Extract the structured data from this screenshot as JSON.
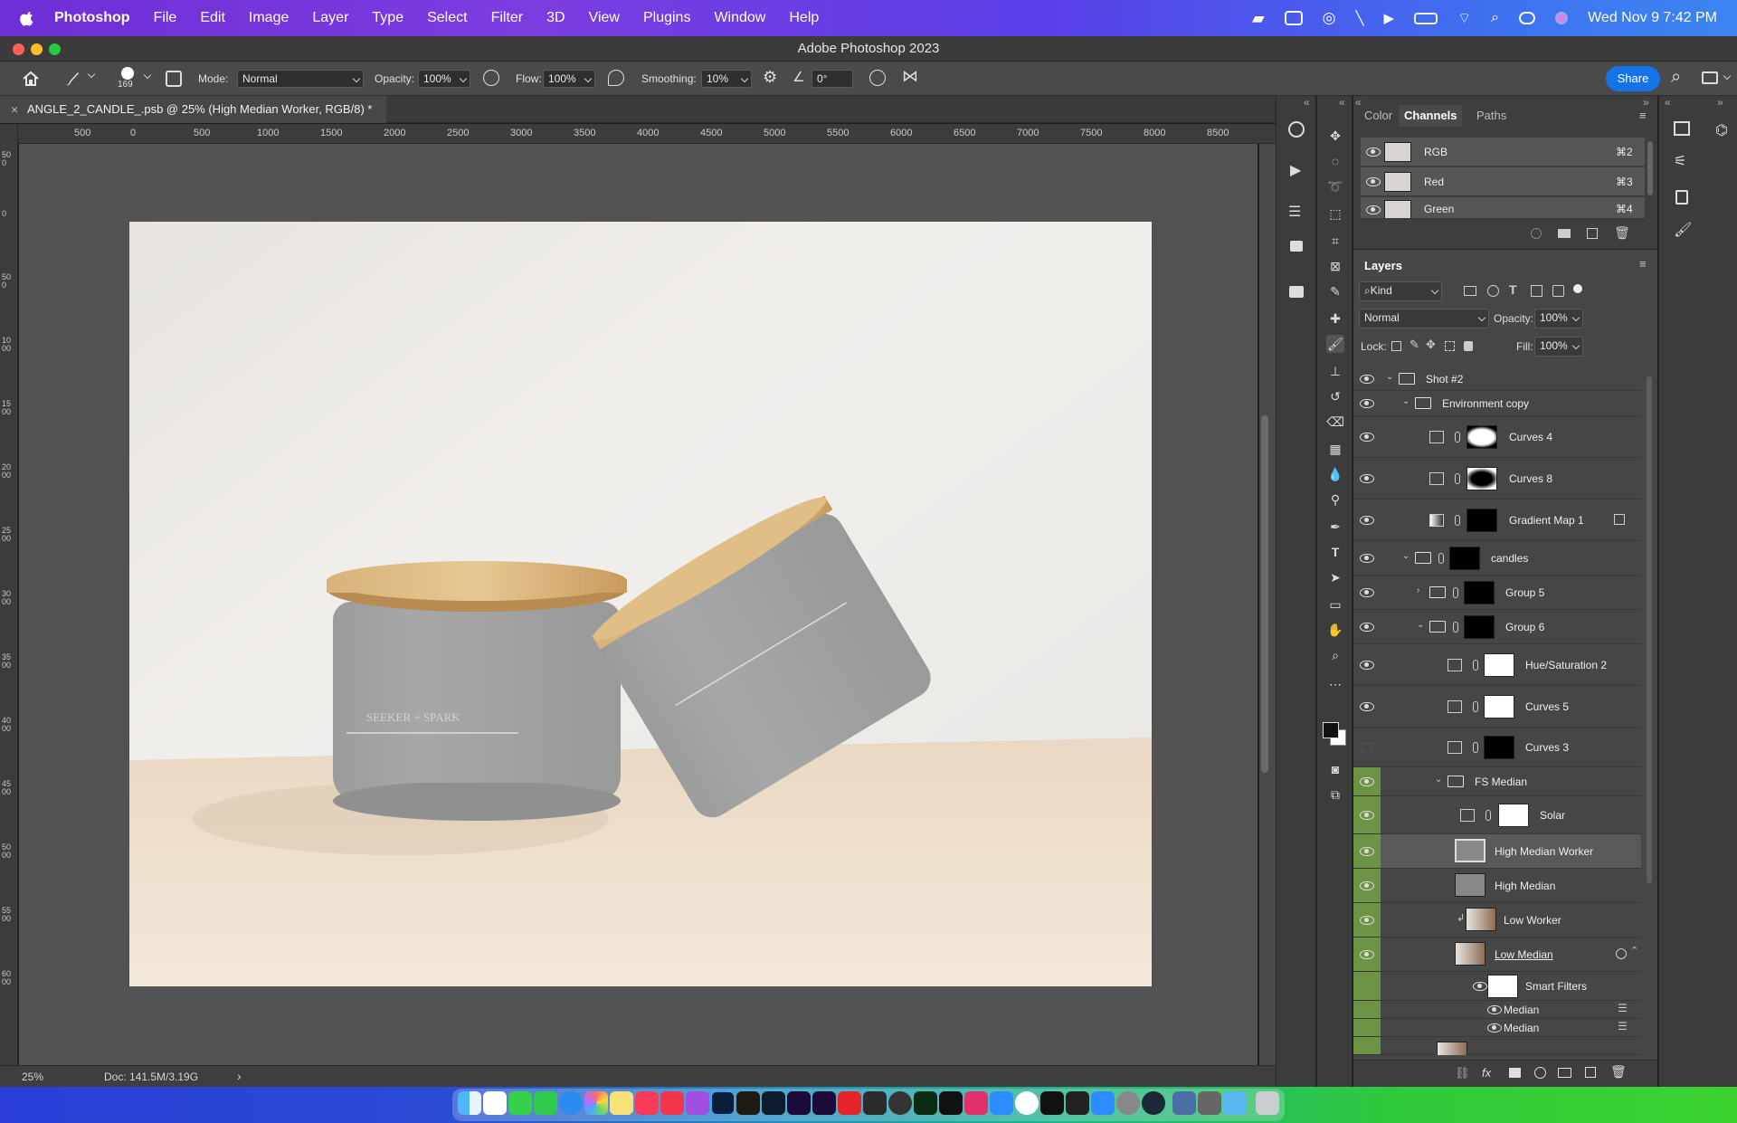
{
  "menubar": {
    "app_name": "Photoshop",
    "menus": [
      "File",
      "Edit",
      "Image",
      "Layer",
      "Type",
      "Select",
      "Filter",
      "3D",
      "View",
      "Plugins",
      "Window",
      "Help"
    ],
    "datetime": "Wed Nov 9  7:42 PM"
  },
  "window": {
    "title": "Adobe Photoshop 2023"
  },
  "options": {
    "brush_size": "169",
    "mode_label": "Mode:",
    "mode_value": "Normal",
    "opacity_label": "Opacity:",
    "opacity_value": "100%",
    "flow_label": "Flow:",
    "flow_value": "100%",
    "smoothing_label": "Smoothing:",
    "smoothing_value": "10%",
    "angle_value": "0°",
    "share_label": "Share"
  },
  "document": {
    "tab_title": "ANGLE_2_CANDLE_.psb @ 25% (High Median Worker, RGB/8) *",
    "zoom": "25%",
    "doc_size": "Doc: 141.5M/3.19G"
  },
  "rulers": {
    "h_labels": [
      "500",
      "0",
      "500",
      "1000",
      "1500",
      "2000",
      "2500",
      "3000",
      "3500",
      "4000",
      "4500",
      "5000",
      "5500",
      "6000",
      "6500",
      "7000",
      "7500",
      "8000",
      "8500"
    ],
    "v_labels": [
      "500",
      "0",
      "500",
      "1000",
      "1500",
      "2000",
      "2500",
      "3000",
      "3500",
      "4000",
      "4500",
      "5000",
      "5500",
      "6000"
    ]
  },
  "channels_panel": {
    "tabs": [
      "Color",
      "Channels",
      "Paths"
    ],
    "active_tab": "Channels",
    "rows": [
      {
        "name": "RGB",
        "shortcut": "⌘2"
      },
      {
        "name": "Red",
        "shortcut": "⌘3"
      },
      {
        "name": "Green",
        "shortcut": "⌘4"
      }
    ]
  },
  "layers_panel": {
    "title": "Layers",
    "filter_kind": "Kind",
    "blend_mode": "Normal",
    "opacity_label": "Opacity:",
    "opacity_value": "100%",
    "lock_label": "Lock:",
    "fill_label": "Fill:",
    "fill_value": "100%",
    "layers": [
      {
        "name": "Shot #2"
      },
      {
        "name": "Environment copy"
      },
      {
        "name": "Curves 4"
      },
      {
        "name": "Curves 8"
      },
      {
        "name": "Gradient Map 1"
      },
      {
        "name": "candles"
      },
      {
        "name": "Group 5"
      },
      {
        "name": "Group 6"
      },
      {
        "name": "Hue/Saturation 2"
      },
      {
        "name": "Curves 5"
      },
      {
        "name": "Curves 3"
      },
      {
        "name": "FS Median"
      },
      {
        "name": "Solar"
      },
      {
        "name": "High Median Worker"
      },
      {
        "name": "High Median"
      },
      {
        "name": "Low Worker"
      },
      {
        "name": "Low Median"
      },
      {
        "name": "Smart Filters"
      },
      {
        "name": "Median"
      },
      {
        "name": "Median"
      }
    ]
  },
  "colors": {
    "accent": "#1473e6",
    "layer_green": "#6c9444"
  }
}
